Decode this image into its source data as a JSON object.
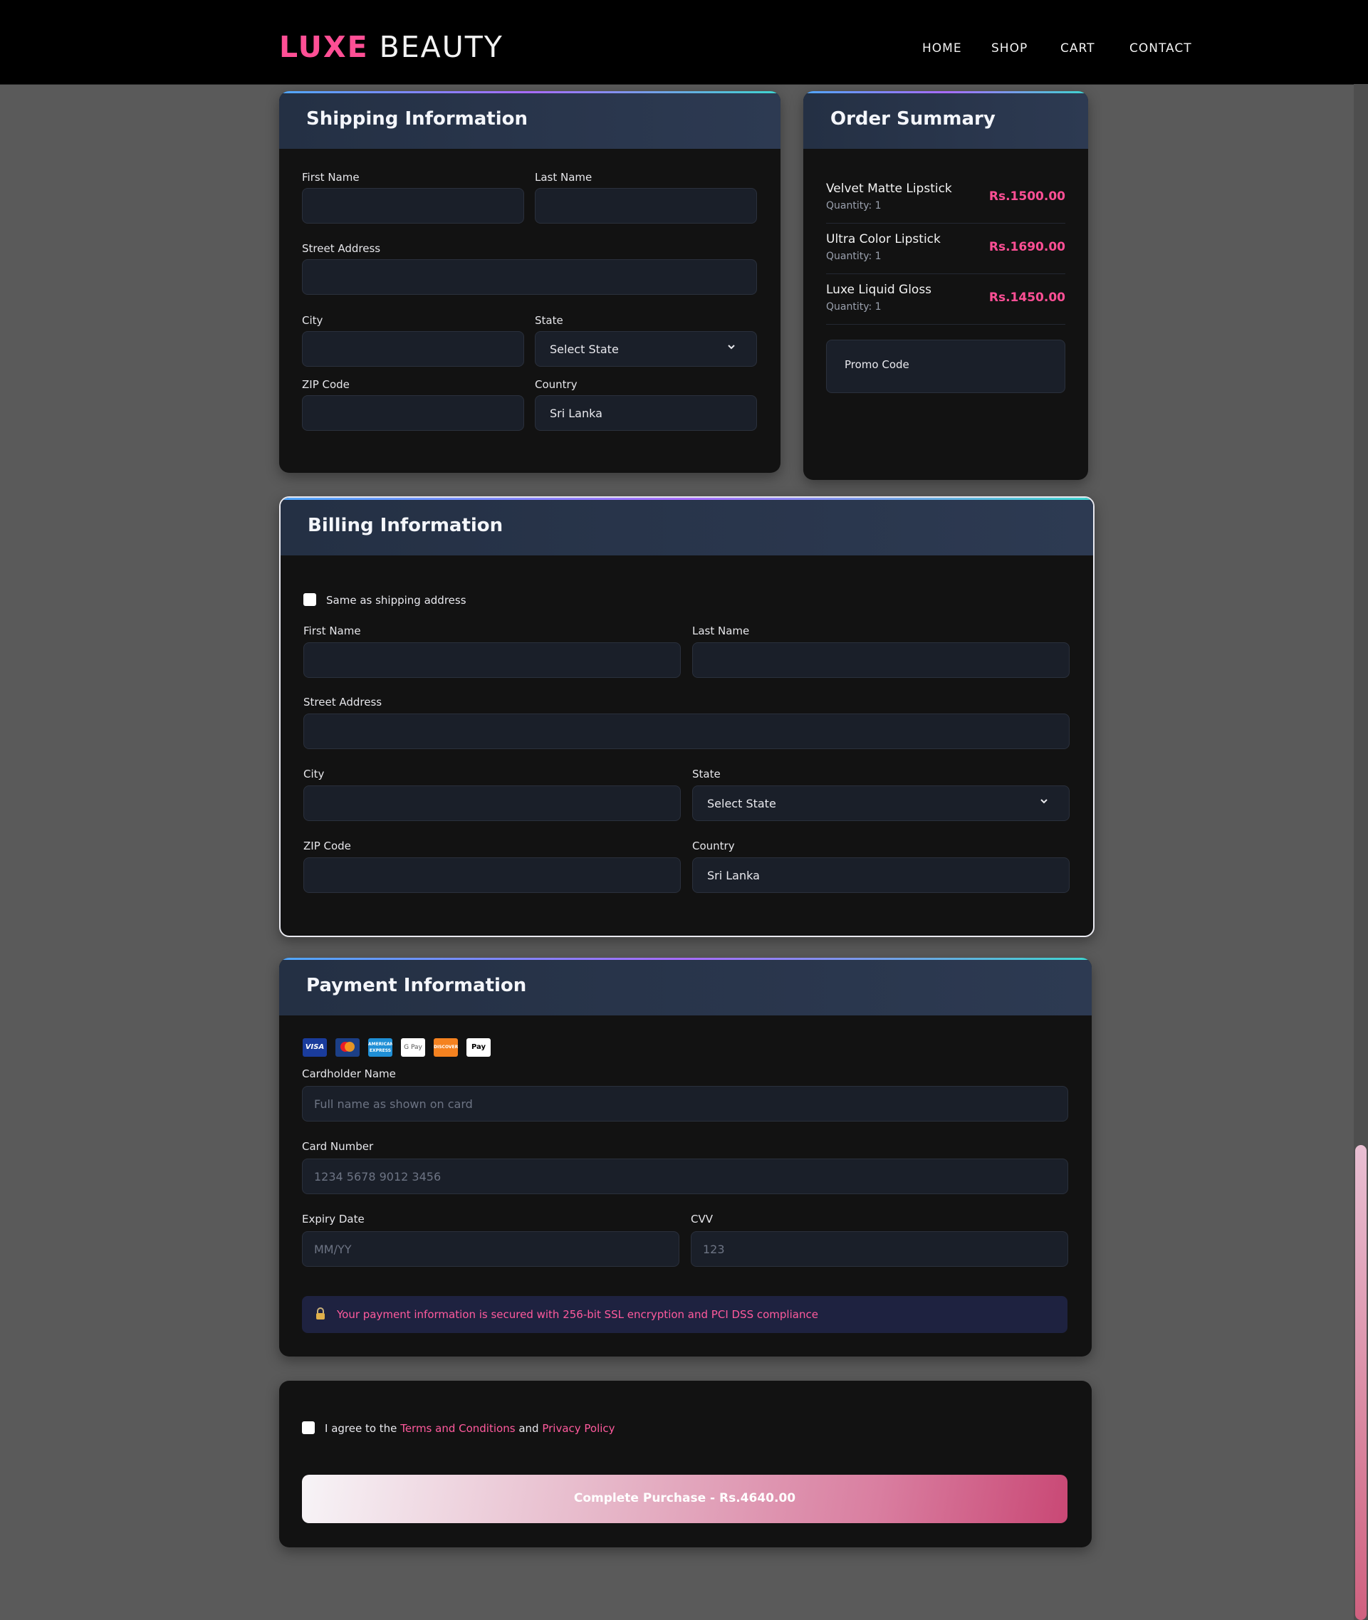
{
  "brand": {
    "part1": "LUXE",
    "part2": "BEAUTY"
  },
  "nav": [
    "HOME",
    "SHOP",
    "CART",
    "CONTACT"
  ],
  "shipping": {
    "title": "Shipping Information",
    "first_name_label": "First Name",
    "last_name_label": "Last Name",
    "street_label": "Street Address",
    "city_label": "City",
    "state_label": "State",
    "state_value": "Select State",
    "zip_label": "ZIP Code",
    "country_label": "Country",
    "country_value": "Sri Lanka"
  },
  "order_summary": {
    "title": "Order Summary",
    "items": [
      {
        "name": "Velvet Matte Lipstick",
        "quantity": "Quantity: 1",
        "price": "Rs.1500.00"
      },
      {
        "name": "Ultra Color Lipstick",
        "quantity": "Quantity: 1",
        "price": "Rs.1690.00"
      },
      {
        "name": "Luxe Liquid Gloss",
        "quantity": "Quantity: 1",
        "price": "Rs.1450.00"
      }
    ],
    "promo_placeholder": "Promo Code"
  },
  "billing": {
    "title": "Billing Information",
    "same_as_shipping": "Same as shipping address",
    "first_name_label": "First Name",
    "last_name_label": "Last Name",
    "street_label": "Street Address",
    "city_label": "City",
    "state_label": "State",
    "state_value": "Select State",
    "zip_label": "ZIP Code",
    "country_label": "Country",
    "country_value": "Sri Lanka"
  },
  "payment": {
    "title": "Payment Information",
    "card_icons": [
      "visa-icon",
      "mastercard-icon",
      "amex-icon",
      "google-pay-icon",
      "discover-icon",
      "apple-pay-icon"
    ],
    "card_icon_text": {
      "visa": "VISA",
      "amex": "AMERICAN EXPRESS",
      "gpay": "G Pay",
      "discover": "DISCOVER",
      "apple": "Pay"
    },
    "cardholder_label": "Cardholder Name",
    "cardholder_placeholder": "Full name as shown on card",
    "card_number_label": "Card Number",
    "card_number_placeholder": "1234 5678 9012 3456",
    "expiry_label": "Expiry Date",
    "expiry_placeholder": "MM/YY",
    "cvv_label": "CVV",
    "cvv_placeholder": "123",
    "secure_icon": "lock-icon",
    "secure_text": "Your payment information is secured with 256-bit SSL encryption and PCI DSS compliance"
  },
  "agreement": {
    "prefix": "I agree to the",
    "terms": "Terms and Conditions",
    "and": "and",
    "privacy": "Privacy Policy"
  },
  "purchase_button": "Complete Purchase - Rs.4640.00",
  "colors": {
    "accent_pink": "#ff4f95",
    "card_bg": "#121212",
    "header_bg": "#243044",
    "page_bg": "#5a5a5a"
  }
}
